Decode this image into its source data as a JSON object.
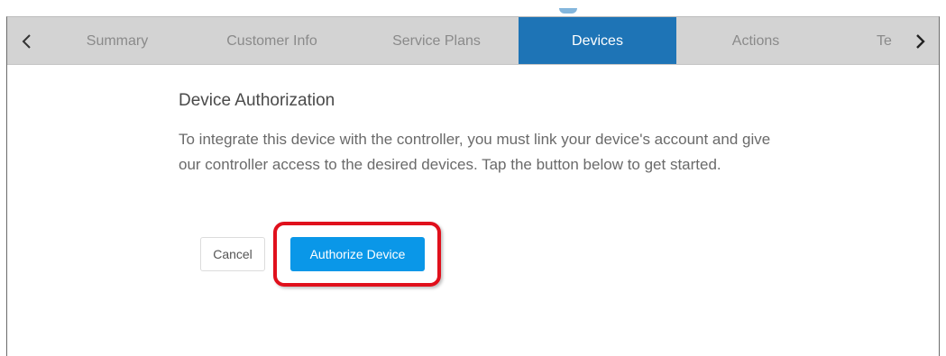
{
  "tabs": [
    {
      "label": "Summary",
      "active": false
    },
    {
      "label": "Customer Info",
      "active": false
    },
    {
      "label": "Service Plans",
      "active": false
    },
    {
      "label": "Devices",
      "active": true
    },
    {
      "label": "Actions",
      "active": false
    },
    {
      "label": "Te",
      "active": false
    }
  ],
  "nav": {
    "left_icon": "chevron-left-icon",
    "right_icon": "chevron-right-icon"
  },
  "panel": {
    "heading": "Device Authorization",
    "description": "To integrate this device with the controller, you must link your device's account and give our controller access to the desired devices. Tap the button below to get started."
  },
  "buttons": {
    "cancel_label": "Cancel",
    "authorize_label": "Authorize Device"
  },
  "colors": {
    "active_tab": "#1e74b6",
    "primary_button": "#0a97e8",
    "highlight_outline": "#e0101c",
    "tabbar_background": "#d3d3d3"
  }
}
